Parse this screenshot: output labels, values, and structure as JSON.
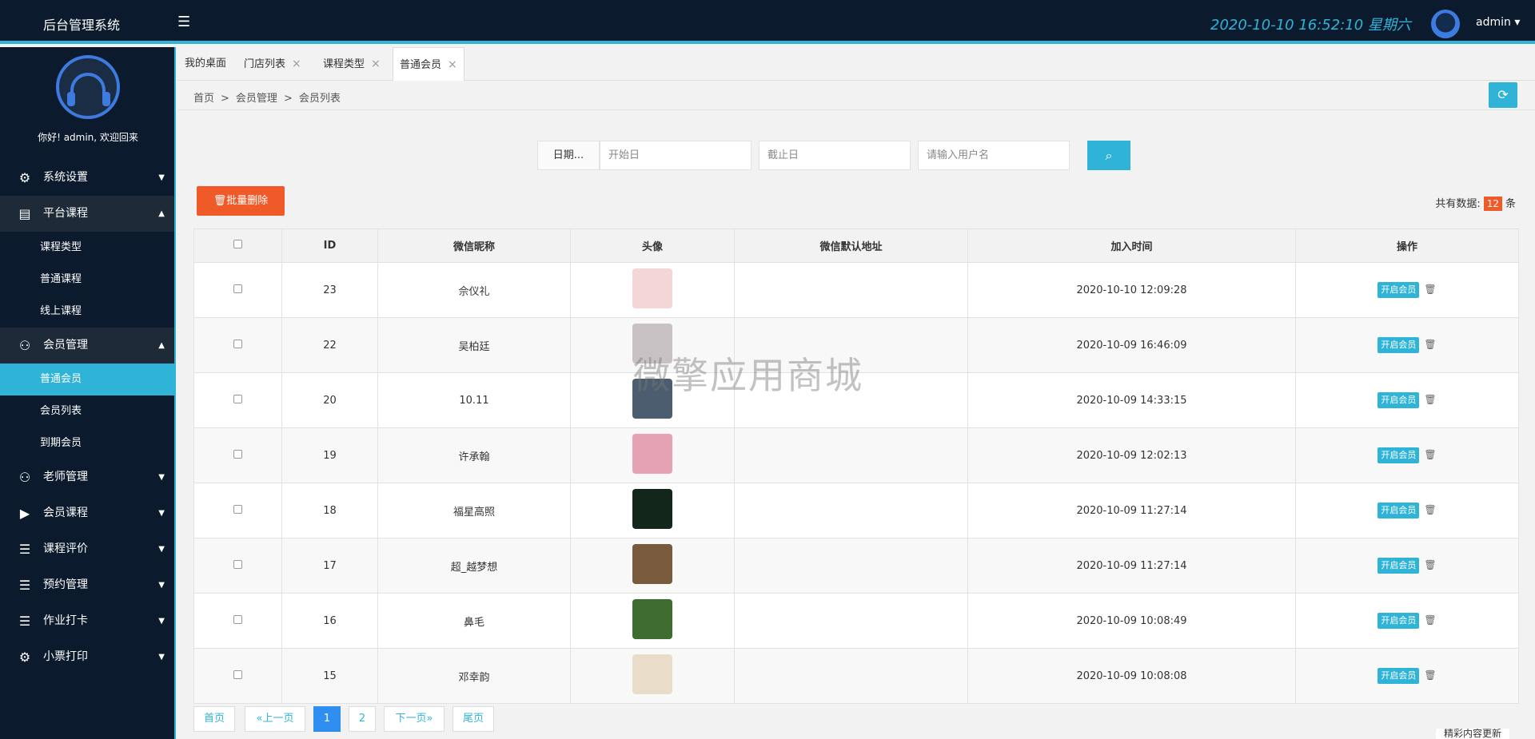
{
  "header": {
    "app_title": "后台管理系统",
    "menu_icon": "hamburger-icon",
    "datetime": "2020-10-10  16:52:10  星期六",
    "user_label": "admin ▾"
  },
  "sidebar": {
    "greeting": "你好! admin, 欢迎回来",
    "items": [
      {
        "label": "系统设置",
        "icon": "⚙",
        "caret": "▼"
      },
      {
        "label": "平台课程",
        "icon": "▤",
        "caret": "▲"
      },
      {
        "label": "课程类型"
      },
      {
        "label": "普通课程"
      },
      {
        "label": "线上课程"
      },
      {
        "label": "会员管理",
        "icon": "⚇",
        "caret": "▲"
      },
      {
        "label": "普通会员"
      },
      {
        "label": "会员列表"
      },
      {
        "label": "到期会员"
      },
      {
        "label": "老师管理",
        "icon": "⚇",
        "caret": "▼"
      },
      {
        "label": "会员课程",
        "icon": "▶",
        "caret": "▼"
      },
      {
        "label": "课程评价",
        "icon": "☰",
        "caret": "▼"
      },
      {
        "label": "预约管理",
        "icon": "☰",
        "caret": "▼"
      },
      {
        "label": "作业打卡",
        "icon": "☰",
        "caret": "▼"
      },
      {
        "label": "小票打印",
        "icon": "⚙",
        "caret": "▼"
      }
    ]
  },
  "tabs": [
    {
      "label": "我的桌面"
    },
    {
      "label": "门店列表",
      "close": "×"
    },
    {
      "label": "课程类型",
      "close": "×"
    },
    {
      "label": "普通会员",
      "close": "×"
    }
  ],
  "breadcrumb": {
    "home": "首页",
    "sep": ">",
    "section": "会员管理",
    "page": "会员列表"
  },
  "refresh_icon": "⟳",
  "search": {
    "date_label": "日期...",
    "start_placeholder": "开始日",
    "end_placeholder": "截止日",
    "user_placeholder": "请输入用户名",
    "search_icon": "⌕"
  },
  "toolbar": {
    "batch_delete": "🗑批量删除",
    "total_prefix": "共有数据:",
    "total_count": "12",
    "total_suffix": "条"
  },
  "table": {
    "headers": [
      "",
      "ID",
      "微信昵称",
      "头像",
      "微信默认地址",
      "加入时间",
      "操作"
    ],
    "rows": [
      {
        "id": "23",
        "nickname": "佘仪礼",
        "address": "",
        "joined": "2020-10-10 12:09:28",
        "avatar_color": "#f4d6d6"
      },
      {
        "id": "22",
        "nickname": "吴柏廷",
        "address": "",
        "joined": "2020-10-09 16:46:09",
        "avatar_color": "#c7c1c4"
      },
      {
        "id": "20",
        "nickname": "10.11",
        "address": "",
        "joined": "2020-10-09 14:33:15",
        "avatar_color": "#4b5d6e"
      },
      {
        "id": "19",
        "nickname": "许承翰",
        "address": "",
        "joined": "2020-10-09 12:02:13",
        "avatar_color": "#e4a2b4"
      },
      {
        "id": "18",
        "nickname": "福星高照",
        "address": "",
        "joined": "2020-10-09 11:27:14",
        "avatar_color": "#13261c"
      },
      {
        "id": "17",
        "nickname": "超_越梦想",
        "address": "",
        "joined": "2020-10-09 11:27:14",
        "avatar_color": "#7a5a3c"
      },
      {
        "id": "16",
        "nickname": "鼻毛",
        "address": "",
        "joined": "2020-10-09 10:08:49",
        "avatar_color": "#3e6b2e"
      },
      {
        "id": "15",
        "nickname": "邓幸韵",
        "address": "",
        "joined": "2020-10-09 10:08:08",
        "avatar_color": "#e9dcc8"
      }
    ],
    "action_label": "开启会员",
    "trash_icon": "🗑"
  },
  "pager": {
    "first": "首页",
    "prev": "«上一页",
    "pages": [
      "1",
      "2"
    ],
    "next": "下一页»",
    "last": "尾页"
  },
  "watermark": "微擎应用商城",
  "corner_tag": "精彩内容更新"
}
